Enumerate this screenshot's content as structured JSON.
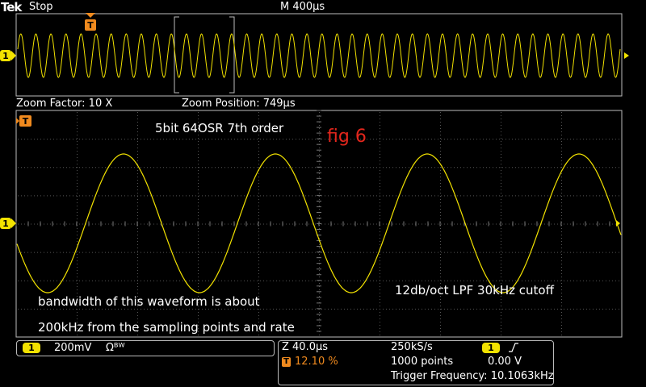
{
  "header": {
    "logo": "Tek",
    "acq_state": "Stop",
    "horizontal_scale": "M 400µs"
  },
  "zoom_info": {
    "factor_label": "Zoom Factor: 10 X",
    "position_label": "Zoom Position: 749µs"
  },
  "annotations": {
    "config": "5bit 64OSR 7th order",
    "fig": "fig 6",
    "filter": "12db/oct LPF 30kHz cutoff",
    "bandwidth_line1": "bandwidth of this waveform is about",
    "bandwidth_line2": "200kHz from the sampling points and rate"
  },
  "channel_panel": {
    "channel": "1",
    "scale": "200mV",
    "coupling": "Ωᴮᵂ"
  },
  "timebase_panel": {
    "zoom_scale": "Z 40.0µs",
    "trigger_pos": "12.10 %",
    "sample_rate": "250kS/s",
    "record_length": "1000 points",
    "trigger_channel": "1",
    "trigger_level": "0.00 V",
    "trigger_frequency": "Trigger Frequency: 10.1063kHz"
  },
  "markers": {
    "channel1": "1",
    "trigger": "T"
  },
  "colors": {
    "trace": "#f2e200",
    "marker_orange": "#f08a1e",
    "annotation_red": "#e3261c",
    "graticule": "#555555"
  },
  "waveforms": {
    "overview_cycles": 40,
    "zoom_cycles": 4.0
  }
}
